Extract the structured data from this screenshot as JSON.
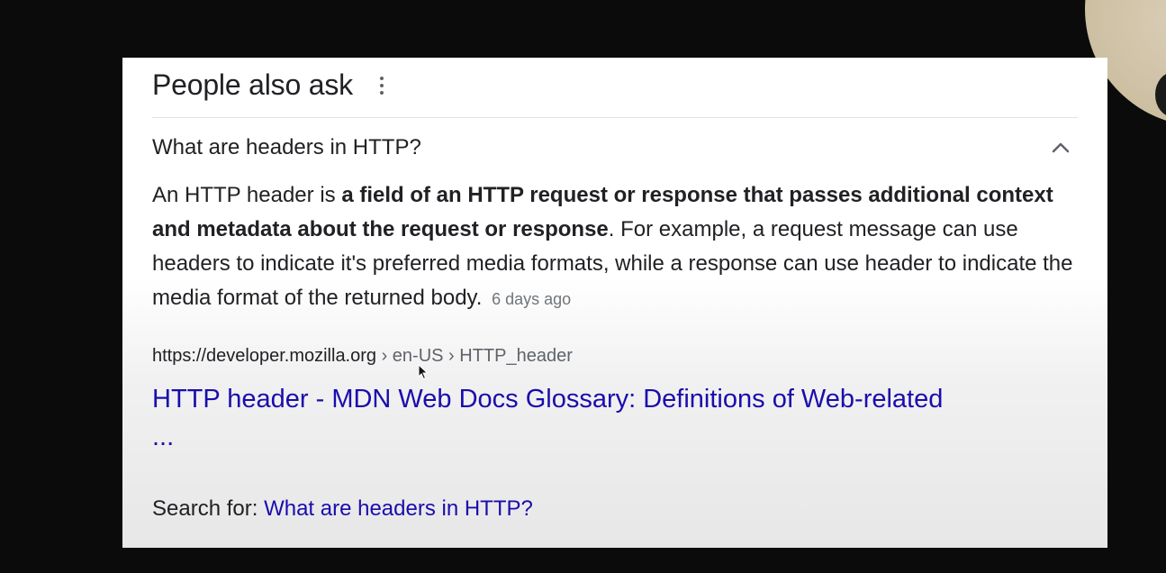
{
  "paa": {
    "title": "People also ask",
    "more_icon": "more-vert-icon",
    "question": "What are headers in HTTP?",
    "toggle_icon": "chevron-up-icon"
  },
  "answer": {
    "text_before": "An HTTP header is ",
    "text_bold": "a field of an HTTP request or response that passes additional context and metadata about the request or response",
    "text_after": ". For example, a request message can use headers to indicate it's preferred media formats, while a response can use header to indicate the media format of the returned body.",
    "date": "6 days ago"
  },
  "source": {
    "domain": "https://developer.mozilla.org",
    "breadcrumbs": " › en-US › HTTP_header",
    "link_title": "HTTP header - MDN Web Docs Glossary: Definitions of Web-related ..."
  },
  "search_for": {
    "label": "Search for: ",
    "query": "What are headers in HTTP?"
  },
  "colors": {
    "link": "#1a0dab",
    "text": "#202124",
    "muted": "#70757a",
    "background": "#0b0b0b"
  }
}
